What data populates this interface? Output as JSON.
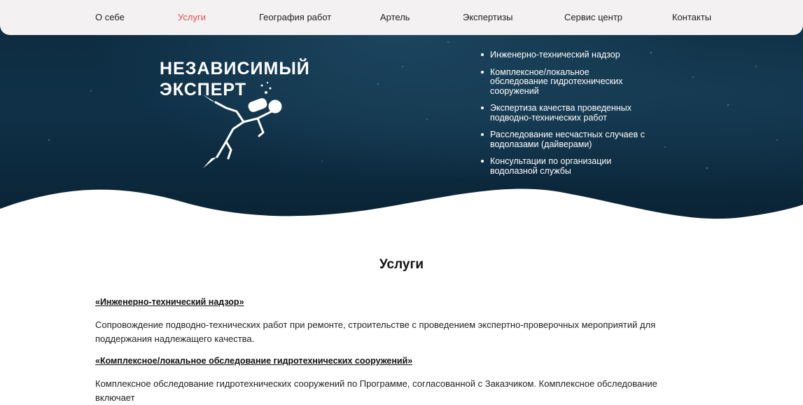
{
  "nav": {
    "items": [
      {
        "label": "О себе"
      },
      {
        "label": "Услуги"
      },
      {
        "label": "География работ"
      },
      {
        "label": "Артель"
      },
      {
        "label": "Экспертизы"
      },
      {
        "label": "Сервис центр"
      },
      {
        "label": "Контакты"
      }
    ],
    "active": "Услуги"
  },
  "hero": {
    "logo": {
      "line1": "НЕЗАВИСИМЫЙ",
      "line2": "ЭКСПЕРТ",
      "icon": "diver-icon"
    },
    "services": [
      "Инженерно-технический надзор",
      "Комплексное/локальное обследование гидротехнических сооружений",
      "Экспертиза качества проведенных подводно-технических работ",
      "Расследование несчастных случаев с водолазами (дайверами)",
      "Консультации по организации водолазной службы"
    ]
  },
  "main": {
    "title": "Услуги",
    "sections": [
      {
        "heading": "«Инженерно-технический надзор»",
        "text": "Сопровождение подводно-технических работ при ремонте, строительстве с проведением экспертно-проверочных мероприятий для поддержания надлежащего качества."
      },
      {
        "heading": "«Комплексное/локальное обследование гидротехнических сооружений»",
        "text": "Комплексное обследование гидротехнических сооружений  по Программе, согласованной с Заказчиком. Комплексное обследование включает"
      }
    ]
  },
  "colors": {
    "nav_bg": "#f3f1f2",
    "active_link": "#e64d4d",
    "hero_bg": "#0f3148"
  }
}
